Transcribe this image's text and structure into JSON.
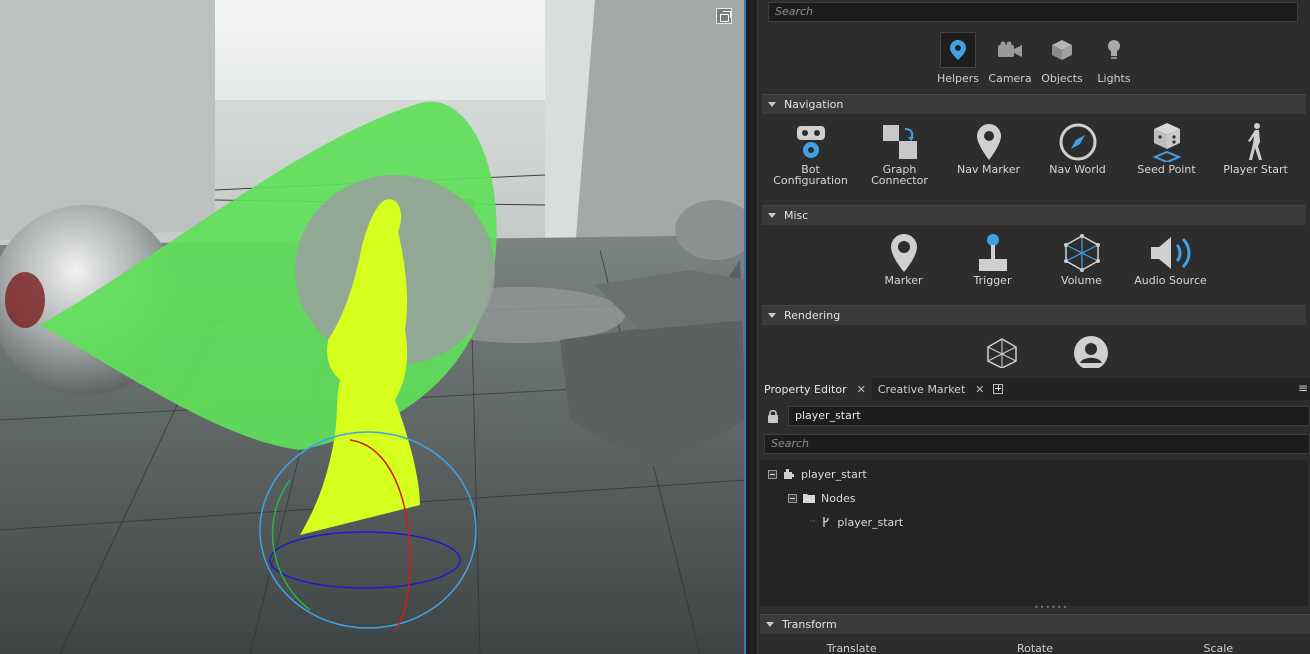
{
  "palette_search": {
    "placeholder": "Search"
  },
  "categories": [
    {
      "label": "Helpers",
      "icon": "map-pin-icon",
      "active": true
    },
    {
      "label": "Camera",
      "icon": "camera-icon"
    },
    {
      "label": "Objects",
      "icon": "cube-icon"
    },
    {
      "label": "Lights",
      "icon": "bulb-icon"
    }
  ],
  "sections": {
    "navigation": {
      "title": "Navigation",
      "items": [
        {
          "label_1": "Bot",
          "label_2": "Configuration",
          "icon": "bot-configuration-icon"
        },
        {
          "label_1": "Graph",
          "label_2": "Connector",
          "icon": "graph-connector-icon"
        },
        {
          "label_1": "Nav Marker",
          "label_2": "",
          "icon": "nav-marker-icon"
        },
        {
          "label_1": "Nav World",
          "label_2": "",
          "icon": "compass-icon"
        },
        {
          "label_1": "Seed Point",
          "label_2": "",
          "icon": "dice-icon"
        },
        {
          "label_1": "Player Start",
          "label_2": "",
          "icon": "walking-person-icon"
        }
      ]
    },
    "misc": {
      "title": "Misc",
      "items": [
        {
          "label": "Marker",
          "icon": "marker-icon"
        },
        {
          "label": "Trigger",
          "icon": "joystick-icon"
        },
        {
          "label": "Volume",
          "icon": "volume-mesh-icon"
        },
        {
          "label": "Audio Source",
          "icon": "speaker-icon"
        }
      ]
    },
    "rendering": {
      "title": "Rendering"
    }
  },
  "dock_tabs": [
    {
      "label": "Property Editor",
      "active": true
    },
    {
      "label": "Creative Market"
    }
  ],
  "property_editor": {
    "name_value": "player_start",
    "search_placeholder": "Search",
    "tree": {
      "root": "player_start",
      "folder": "Nodes",
      "leaf": "player_start"
    },
    "transform": {
      "title": "Transform",
      "columns": [
        "Translate",
        "Rotate",
        "Scale"
      ]
    }
  },
  "colors": {
    "accent": "#2f7fb8",
    "icon_blue": "#3fa2e6",
    "gizmo_green": "#5fe05a",
    "figure_yellow": "#d6ff1e"
  }
}
